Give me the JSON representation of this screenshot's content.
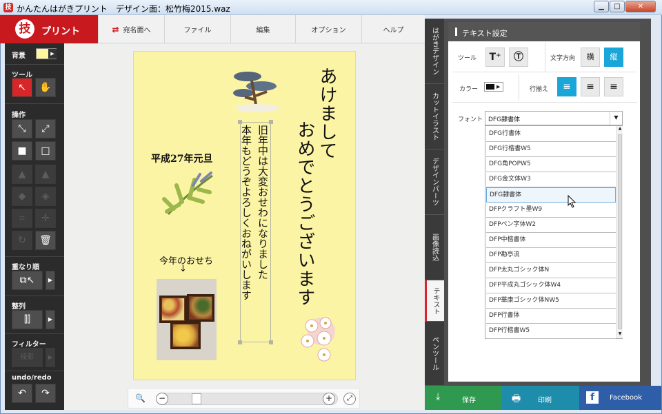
{
  "window": {
    "title": "かんたんはがきプリント　デザイン面：松竹梅2015.waz",
    "icon": "app-icon",
    "controls": [
      "minimize",
      "maximize",
      "close"
    ]
  },
  "brand": {
    "mark": "技",
    "name": "プリント"
  },
  "menu": {
    "address": "宛名面へ",
    "file": "ファイル",
    "edit": "編集",
    "option": "オプション",
    "help": "ヘルプ"
  },
  "left": {
    "background": "背景",
    "tools": "ツール",
    "operations": "操作",
    "order": "重なり順",
    "align": "整列",
    "filter": "フィルター",
    "filter_value": "段影",
    "undo_redo": "undo/redo"
  },
  "card": {
    "greeting_col1": "あけまして",
    "greeting_col2": "おめでとうございます",
    "date": "平成27年元旦",
    "message_col1": "旧年中は大変おせわになりました",
    "message_col2": "本年もどうぞよろしくおねがいします",
    "caption": "今年のおせち",
    "arrow": "↓"
  },
  "zoom": {
    "minus": "−",
    "plus": "+",
    "level": 0.18
  },
  "side_tabs": [
    "はがきデザイン",
    "カットイラスト",
    "デザインパーツ",
    "画像読込",
    "テキスト",
    "ペンツール"
  ],
  "panel": {
    "title": "テキスト設定",
    "tool_label": "ツール",
    "direction_label": "文字方向",
    "dir_h": "横",
    "dir_v": "縦",
    "color_label": "カラー",
    "align_label": "行揃え",
    "font_label": "フォント",
    "font_selected": "DFG隷書体",
    "fonts": [
      "DFG行書体",
      "DFG行楷書W5",
      "DFG角POPW5",
      "DFG金文体W3",
      "DFG隷書体",
      "DFPクラフト墨W9",
      "DFPペン字体W2",
      "DFP中楷書体",
      "DFP勘亭流",
      "DFP太丸ゴシック体N",
      "DFP平成丸ゴシック体W4",
      "DFP華康ゴシック体NW5",
      "DFP行書体",
      "DFP行楷書W5"
    ],
    "hover_index": 4
  },
  "bottom": {
    "save": "保存",
    "print": "印刷",
    "facebook": "Facebook"
  },
  "colors": {
    "brand": "#c8191f",
    "accent": "#1aa6d8",
    "save": "#2f9a4f",
    "print": "#1d8dab",
    "facebook": "#2f5ea8",
    "card": "#fbf4a5"
  }
}
